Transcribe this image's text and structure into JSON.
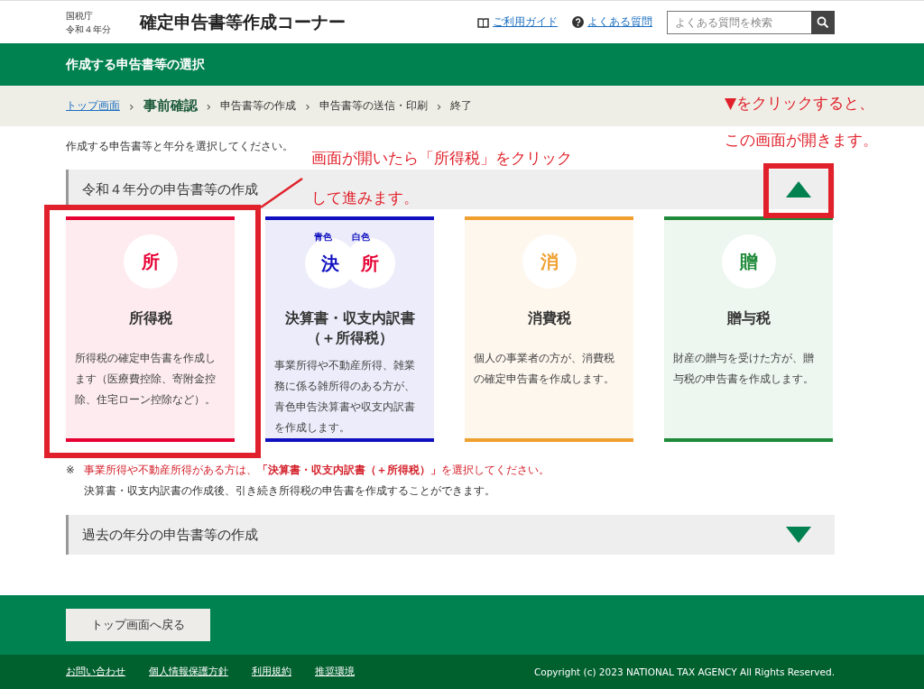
{
  "header": {
    "agency": "国税庁",
    "year": "令和４年分",
    "title": "確定申告書等作成コーナー",
    "links": [
      {
        "kind": "guide",
        "label": "ご利用ガイド"
      },
      {
        "kind": "faq",
        "label": "よくある質問"
      }
    ],
    "search": {
      "placeholder": "よくある質問を検索"
    }
  },
  "page_title": "作成する申告書等の選択",
  "breadcrumb": {
    "separator": "›",
    "items": [
      {
        "kind": "link",
        "label": "トップ画面"
      },
      {
        "kind": "current",
        "label": "事前確認"
      },
      {
        "kind": "plain",
        "label": "申告書等の作成"
      },
      {
        "kind": "plain",
        "label": "申告書等の送信・印刷"
      },
      {
        "kind": "plain",
        "label": "終了"
      }
    ]
  },
  "instruction": "作成する申告書等と年分を選択してください。",
  "sections": [
    {
      "title": "令和４年分の申告書等の作成",
      "expanded": true
    },
    {
      "title": "過去の年分の申告書等の作成",
      "expanded": false
    }
  ],
  "cards": [
    {
      "kind": "single",
      "color": "#e60033",
      "badge": "所",
      "title": "所得税",
      "description": "所得税の確定申告書を作成します（医療費控除、寄附金控除、住宅ローン控除など）。"
    },
    {
      "kind": "double",
      "color": "#1010c0",
      "badges": [
        {
          "label": "青色",
          "char": "決",
          "color": "#1010c0"
        },
        {
          "label": "白色",
          "char": "所",
          "color": "#e60033"
        }
      ],
      "title": "決算書・収支内訳書（＋所得税）",
      "description": "事業所得や不動産所得、雑業務に係る雑所得のある方が、青色申告決算書や収支内訳書を作成します。"
    },
    {
      "kind": "single",
      "color": "#f0a030",
      "badge": "消",
      "title": "消費税",
      "description": "個人の事業者の方が、消費税の確定申告書を作成します。"
    },
    {
      "kind": "single",
      "color": "#1e8a3a",
      "badge": "贈",
      "title": "贈与税",
      "description": "財産の贈与を受けた方が、贈与税の申告書を作成します。"
    }
  ],
  "note": {
    "mark": "※",
    "lines": [
      "事業所得や不動産所得がある方は、**「決算書・収支内訳書（＋所得税）」**を選択してください。",
      "決算書・収支内訳書の作成後、引き続き所得税の申告書を作成することができます。"
    ]
  },
  "back_button": "トップ画面へ戻る",
  "footer": {
    "links": [
      "お問い合わせ",
      "個人情報保護方針",
      "利用規約",
      "推奨環境"
    ],
    "copyright": "Copyright (c) 2023 NATIONAL TAX AGENCY All Rights Reserved."
  },
  "annotations": {
    "top_note": [
      "▼をクリックすると、",
      "この画面が開きます。"
    ],
    "callout": [
      "画面が開いたら「所得税」をクリック",
      "して進みます。"
    ]
  }
}
